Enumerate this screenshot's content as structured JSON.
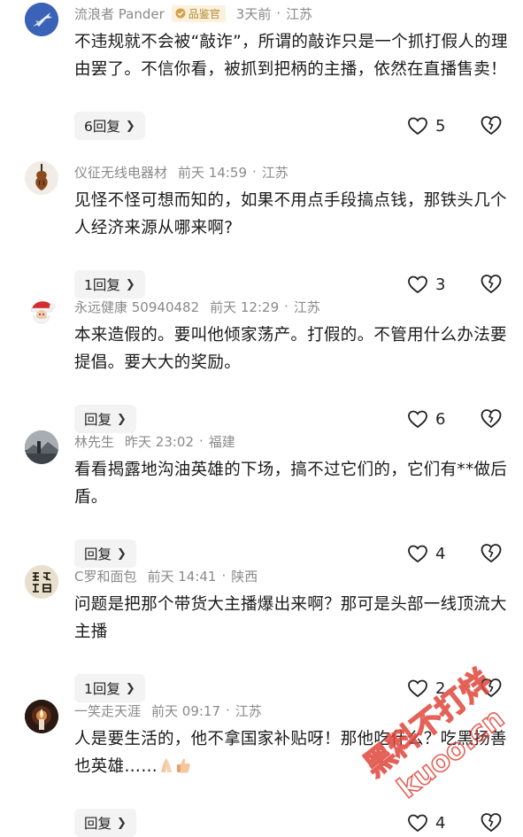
{
  "comments": [
    {
      "user": "流浪者 Pander",
      "badge": "品鉴官",
      "time": "3天前",
      "location": "江苏",
      "text": "不违规就不会被“敲诈”，所谓的敲诈只是一个抓打假人的理由罢了。不信你看，被抓到把柄的主播，依然在直播售卖！",
      "reply_label": "6回复",
      "likes": "5",
      "avatar_icon": "fighter-jet-avatar"
    },
    {
      "user": "仪征无线电器材",
      "time": "前天 14:59",
      "location": "江苏",
      "text": "见怪不怪可想而知的，如果不用点手段搞点钱，那铁头几个人经济来源从哪来啊?",
      "reply_label": "1回复",
      "likes": "3",
      "avatar_icon": "violin-avatar"
    },
    {
      "user": "永远健康 50940482",
      "time": "前天 12:29",
      "location": "江苏",
      "text": "本来造假的。要叫他倾家荡产。打假的。不管用什么办法要提倡。要大大的奖励。",
      "reply_label": "回复",
      "likes": "6",
      "avatar_icon": "santa-avatar"
    },
    {
      "user": "林先生",
      "time": "昨天 23:02",
      "location": "福建",
      "text": "看看揭露地沟油英雄的下场，搞不过它们的，它们有**做后盾。",
      "reply_label": "回复",
      "likes": "4",
      "avatar_icon": "landscape-avatar"
    },
    {
      "user": "C罗和面包",
      "time": "前天 14:41",
      "location": "陕西",
      "text": "问题是把那个带货大主播爆出来啊？那可是头部一线顶流大主播",
      "reply_label": "1回复",
      "likes": "2",
      "avatar_icon": "calligraphy-avatar"
    },
    {
      "user": "一笑走天涯",
      "time": "前天 09:17",
      "location": "江苏",
      "text": "人是要生活的，他不拿国家补贴呀！那他吃什么？吃黑扬善也英雄……",
      "reply_label": "回复",
      "likes": "4",
      "avatar_icon": "candle-avatar"
    }
  ],
  "icons": {
    "like": "heart-outline-icon",
    "dislike": "broken-heart-icon",
    "reply_chevron": "chevron-right-icon",
    "badge": "verified-badge-icon"
  },
  "watermark": {
    "line1": "黑料不打烊",
    "line2": "kuoo.cn",
    "color": "#e0463c"
  }
}
